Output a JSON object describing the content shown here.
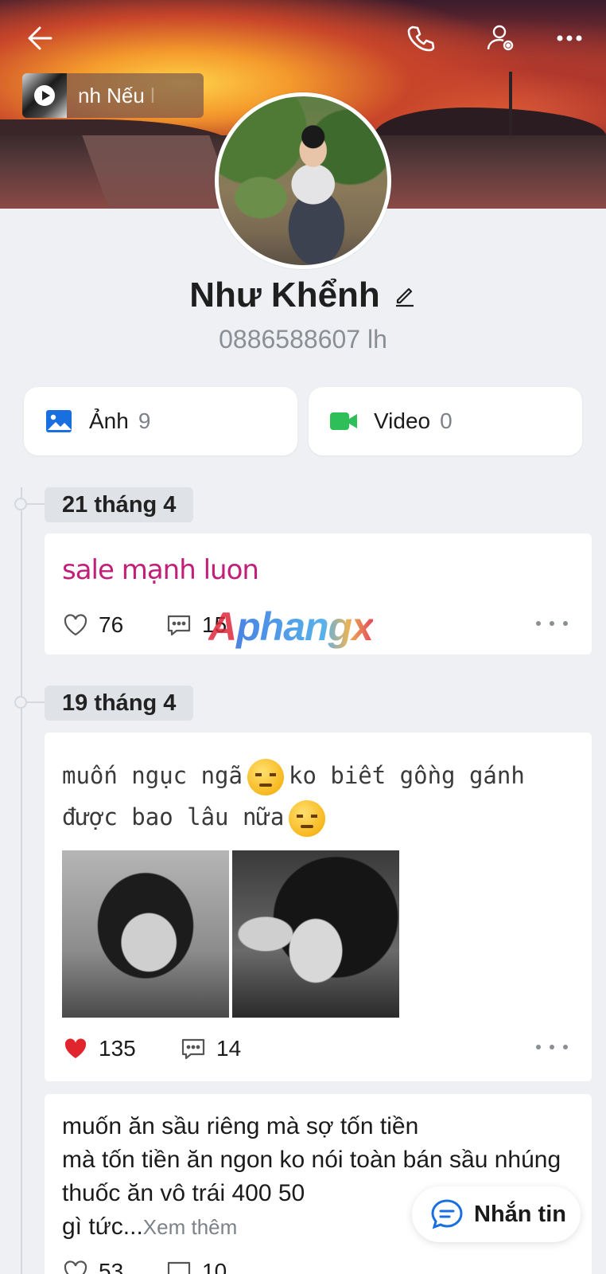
{
  "header": {
    "music_text": "nh     Nếu l",
    "icons": [
      "back-arrow-icon",
      "phone-icon",
      "user-settings-icon",
      "more-icon"
    ]
  },
  "profile": {
    "name": "Như Khểnh",
    "subtitle": "0886588607 lh"
  },
  "media": {
    "photos_label": "Ảnh",
    "photos_count": "9",
    "videos_label": "Video",
    "videos_count": "0"
  },
  "watermark": "Aphangx",
  "timeline": [
    {
      "date": "21 tháng 4",
      "posts": [
        {
          "text": "sale mạnh luon",
          "likes": "76",
          "comments": "15",
          "liked": false
        }
      ]
    },
    {
      "date": "19 tháng 4",
      "posts": [
        {
          "text_line1": "muốn ngục ngã",
          "text_line1b": "ko biết gồng gánh",
          "text_line2": "được bao lâu nữa",
          "likes": "135",
          "comments": "14",
          "liked": true,
          "photo_count": 2
        },
        {
          "text": "muốn ăn sầu riêng mà sợ tốn tiền\nmà tốn tiền ăn ngon ko nói toàn bán sầu nhúng thuốc ăn vô trái 400 50",
          "text_end": "gì tức...",
          "see_more": "Xem thêm",
          "likes": "53",
          "comments": "10"
        }
      ]
    }
  ],
  "fab": {
    "label": "Nhắn tin"
  },
  "colors": {
    "accent_blue": "#1a6fe0",
    "video_green": "#2fbf58",
    "like_red": "#e0262c",
    "fancy_text": "#c21f78"
  }
}
